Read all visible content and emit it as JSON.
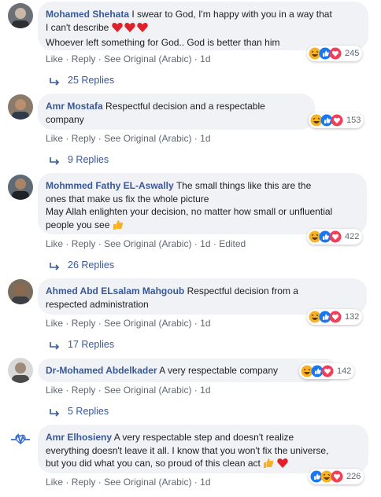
{
  "separator": "·",
  "comments": [
    {
      "author": "Mohamed Shehata",
      "lines": [
        "I swear to God, I'm happy with you in a way that",
        "I can't describe",
        "Whoever left something for God.. God is better than him"
      ],
      "actions": {
        "like": "Like",
        "reply": "Reply",
        "see_original": "See Original (Arabic)",
        "time": "1d"
      },
      "reaction_count": "245",
      "replies": "25 Replies"
    },
    {
      "author": "Amr Mostafa",
      "lines": [
        "Respectful decision and a respectable",
        "company"
      ],
      "actions": {
        "like": "Like",
        "reply": "Reply",
        "see_original": "See Original (Arabic)",
        "time": "1d"
      },
      "reaction_count": "153",
      "replies": "9 Replies"
    },
    {
      "author": "Mohmmed Fathy EL-Aswally",
      "lines": [
        "The small things like this are the",
        "ones that make us fix the whole picture",
        "May Allah enlighten your decision, no matter how small or unfluential",
        "people you see"
      ],
      "actions": {
        "like": "Like",
        "reply": "Reply",
        "see_original": "See Original (Arabic)",
        "time": "1d",
        "edited": "Edited"
      },
      "reaction_count": "422",
      "replies": "26 Replies"
    },
    {
      "author": "Ahmed Abd ELsalam Mahgoub",
      "lines": [
        "Respectful decision from a",
        "respected administration"
      ],
      "actions": {
        "like": "Like",
        "reply": "Reply",
        "see_original": "See Original (Arabic)",
        "time": "1d"
      },
      "reaction_count": "132",
      "replies": "17 Replies"
    },
    {
      "author": "Dr-Mohamed Abdelkader",
      "lines": [
        "A very respectable company"
      ],
      "actions": {
        "like": "Like",
        "reply": "Reply",
        "see_original": "See Original (Arabic)",
        "time": "1d"
      },
      "reaction_count": "142",
      "replies": "5 Replies"
    },
    {
      "author": "Amr Elhosieny",
      "lines": [
        "A very respectable step and doesn't realize",
        "everything doesn't leave it all. I know that you won't fix the universe,",
        "but you did what you can, so proud of this clean act"
      ],
      "actions": {
        "like": "Like",
        "reply": "Reply",
        "see_original": "See Original (Arabic)",
        "time": "1d"
      },
      "reaction_count": "226"
    }
  ],
  "colors": {
    "author": "#385898",
    "bubble": "#f0f2f5",
    "meta": "#606770",
    "like_blue": "#1877f2",
    "love_red": "#f33e58",
    "haha_yellow": "#f7b125"
  }
}
